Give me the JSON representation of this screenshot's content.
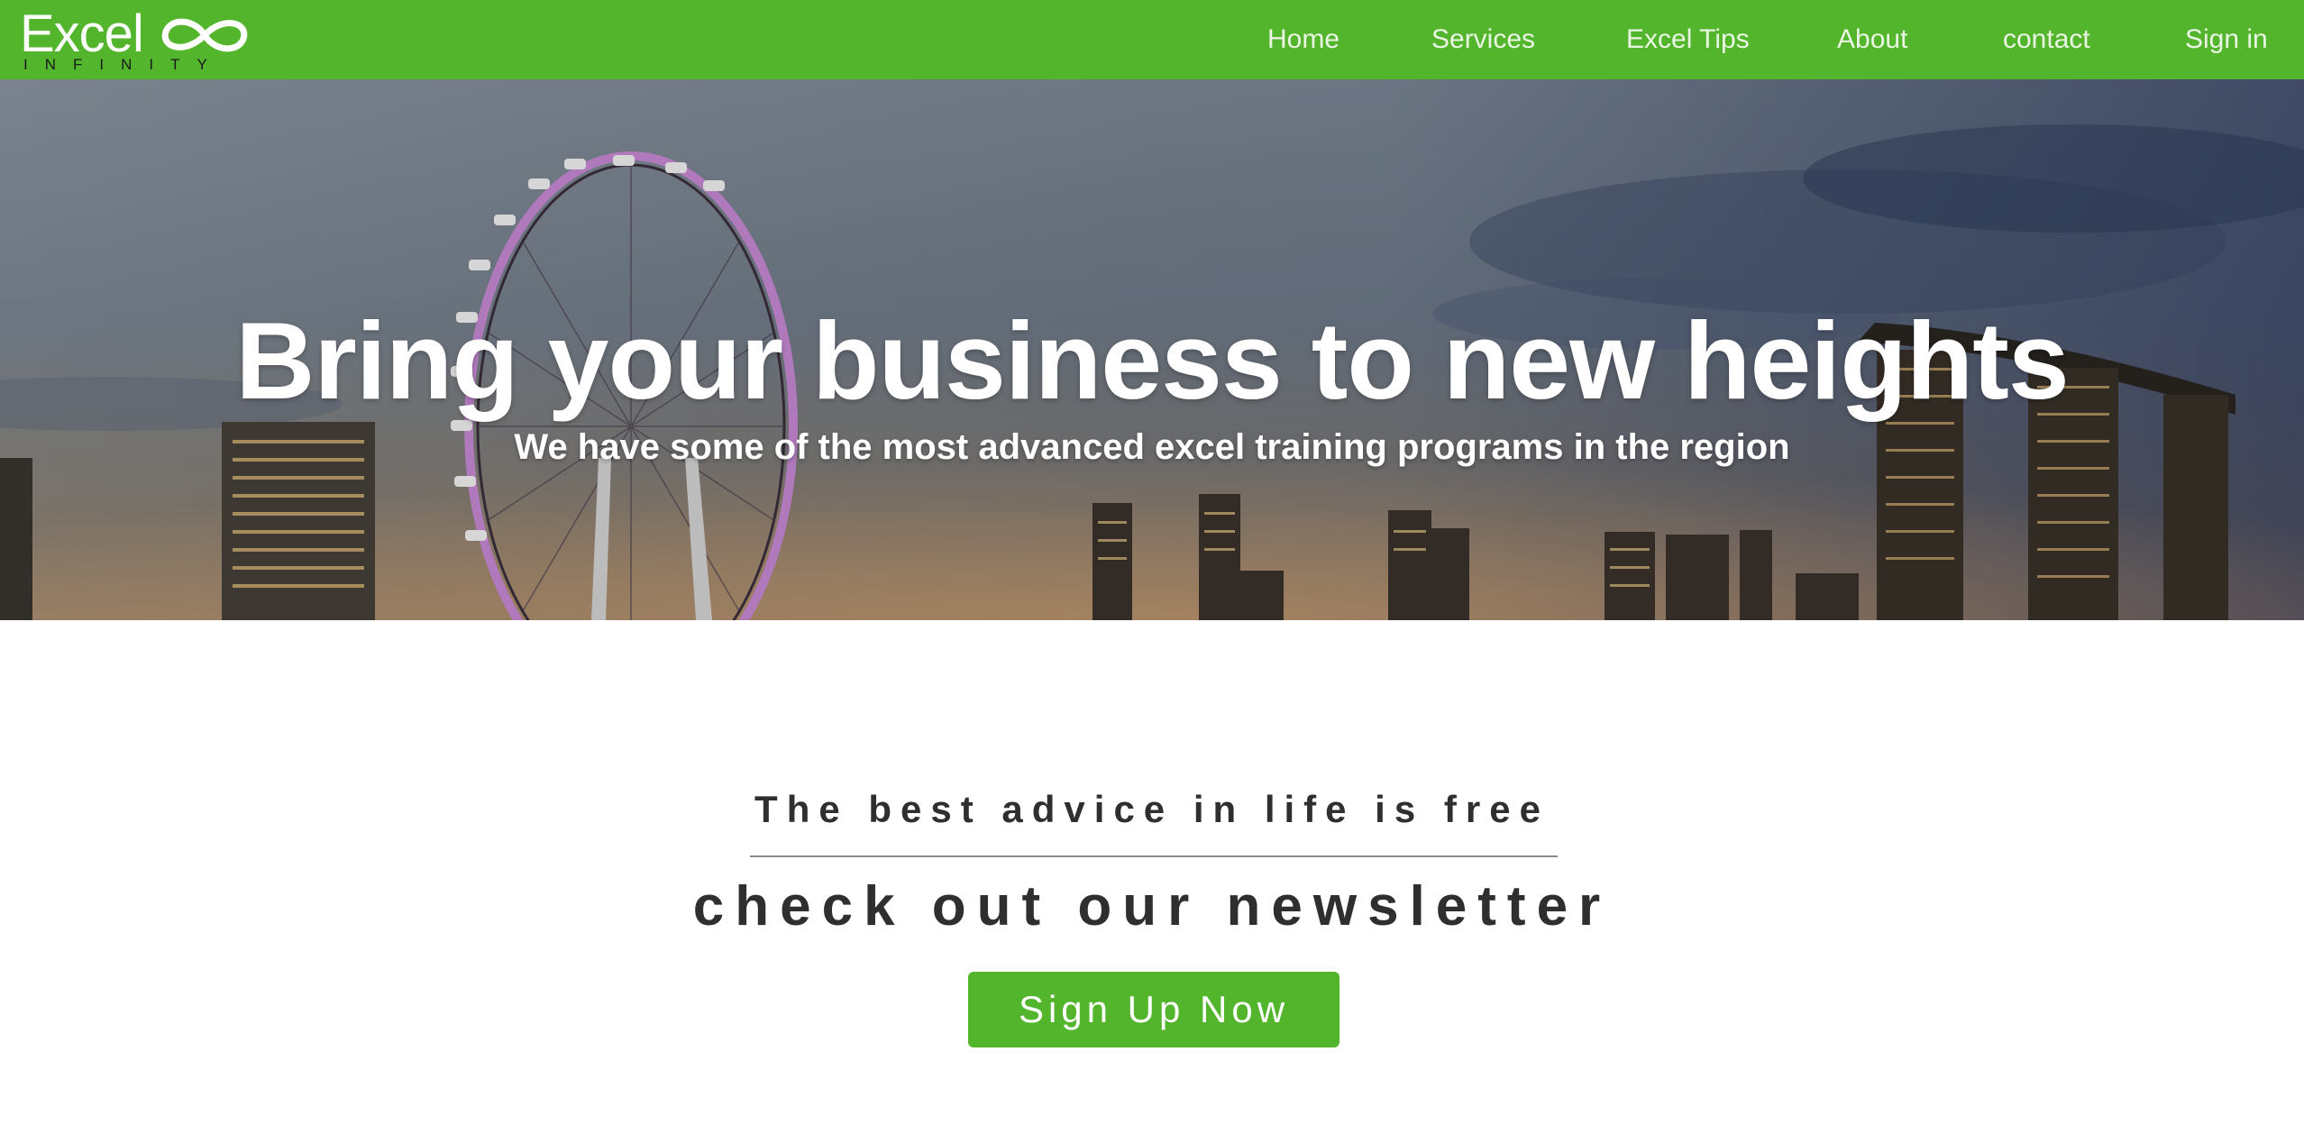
{
  "brand": {
    "name": "Excel",
    "tagline": "INFINITY",
    "logo_icon": "infinity-icon",
    "color_primary": "#52b52c"
  },
  "nav": {
    "items": [
      {
        "label": "Home"
      },
      {
        "label": "Services"
      },
      {
        "label": "Excel Tips"
      },
      {
        "label": "About"
      },
      {
        "label": "contact"
      },
      {
        "label": "Sign in"
      }
    ]
  },
  "hero": {
    "title": "Bring your business to new heights",
    "subtitle": "We have some of the most advanced excel training programs in the region"
  },
  "newsletter": {
    "heading": "The best advice in life is free",
    "title": "check out our newsletter",
    "button_label": "Sign Up Now"
  }
}
